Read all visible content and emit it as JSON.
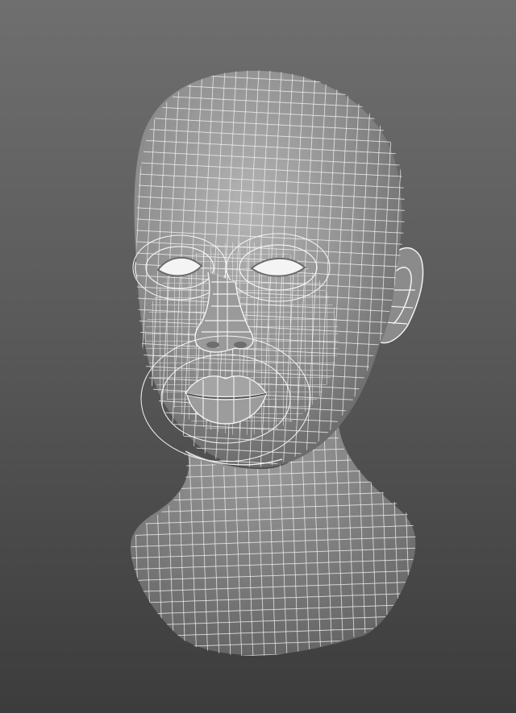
{
  "scene": {
    "subject": "",
    "background_top": "#6f6f6f",
    "background_bottom": "#3c3c3c",
    "mesh_fill": "#8f8f8f",
    "wire_color": "#f2f2f2"
  }
}
